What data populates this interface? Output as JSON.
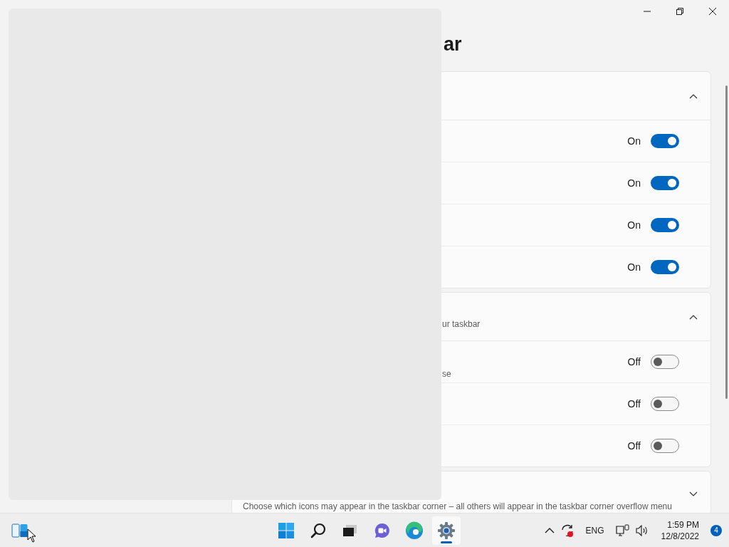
{
  "page_title": "ar",
  "sections": [
    {
      "expanded": true,
      "rows": [
        {
          "state_label": "On",
          "on": true
        },
        {
          "state_label": "On",
          "on": true
        },
        {
          "state_label": "On",
          "on": true
        },
        {
          "state_label": "On",
          "on": true
        }
      ]
    },
    {
      "expanded": true,
      "subtitle": "ur taskbar",
      "rows": [
        {
          "description": "se",
          "state_label": "Off",
          "on": false
        },
        {
          "state_label": "Off",
          "on": false
        },
        {
          "state_label": "Off",
          "on": false
        }
      ]
    },
    {
      "expanded": false,
      "subtitle": "Choose which icons may appear in the taskbar corner – all others will appear in the taskbar corner overflow menu"
    }
  ],
  "taskbar": {
    "apps": [
      {
        "kind": "start",
        "active": false
      },
      {
        "kind": "search",
        "active": false
      },
      {
        "kind": "taskview",
        "active": false
      },
      {
        "kind": "chat",
        "active": false
      },
      {
        "kind": "edge",
        "active": false
      },
      {
        "kind": "settings",
        "active": true
      }
    ],
    "language": "ENG",
    "time": "1:59 PM",
    "date": "12/8/2022",
    "notification_count": "4"
  }
}
